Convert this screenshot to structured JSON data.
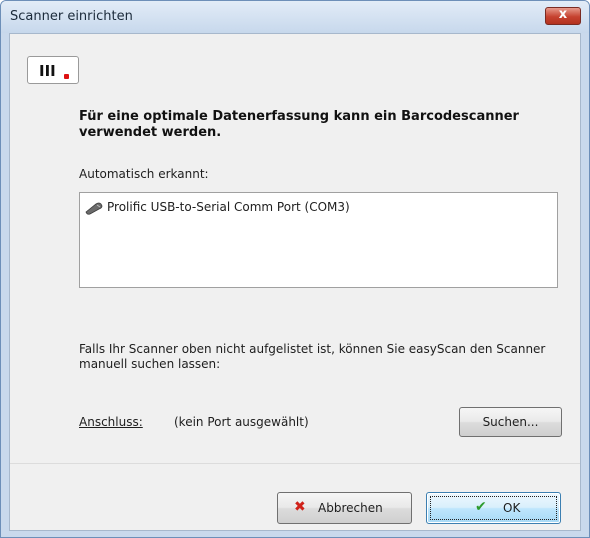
{
  "window": {
    "title": "Scanner einrichten",
    "close_symbol": "x"
  },
  "logo": {
    "text": "III.",
    "accent_color": "#dd1111"
  },
  "main": {
    "heading": "Für eine optimale Datenerfassung kann ein Barcodescanner verwendet werden.",
    "auto_label": "Automatisch erkannt:",
    "detected_devices": [
      {
        "label": "Prolific USB-to-Serial Comm Port (COM3)",
        "icon": "scanner-icon"
      }
    ],
    "info_text": "Falls Ihr Scanner oben nicht aufgelistet ist, können Sie easyScan den Scanner manuell suchen lassen:",
    "port_label": "Anschluss:",
    "port_value": "(kein Port ausgewählt)",
    "search_button": "Suchen..."
  },
  "footer": {
    "cancel_label": "Abbrechen",
    "cancel_icon": "cross-icon",
    "ok_label": "OK",
    "ok_icon": "checkmark-icon"
  }
}
